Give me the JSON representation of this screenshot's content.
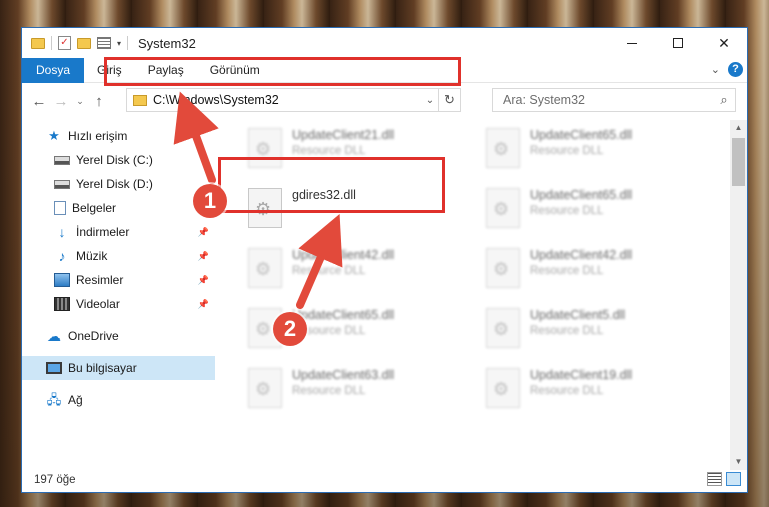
{
  "window": {
    "title": "System32"
  },
  "ribbon": {
    "tabs": [
      "Dosya",
      "Giriş",
      "Paylaş",
      "Görünüm"
    ],
    "help": "?"
  },
  "navigation": {
    "back": "←",
    "forward": "→",
    "recent": "⌄",
    "up": "↑",
    "address": "C:\\Windows\\System32",
    "refresh": "↻",
    "search_placeholder": "Ara: System32"
  },
  "sidebar": {
    "items": [
      {
        "label": "Hızlı erişim",
        "icon": "star-icon"
      },
      {
        "label": "Yerel Disk (C:)",
        "icon": "disk-icon"
      },
      {
        "label": "Yerel Disk (D:)",
        "icon": "disk-icon"
      },
      {
        "label": "Belgeler",
        "icon": "documents-icon"
      },
      {
        "label": "İndirmeler",
        "icon": "download-icon",
        "pinned": true
      },
      {
        "label": "Müzik",
        "icon": "music-icon",
        "pinned": true
      },
      {
        "label": "Resimler",
        "icon": "pictures-icon",
        "pinned": true
      },
      {
        "label": "Videolar",
        "icon": "videos-icon",
        "pinned": true
      },
      {
        "label": "OneDrive",
        "icon": "cloud-icon"
      },
      {
        "label": "Bu bilgisayar",
        "icon": "computer-icon",
        "selected": true
      },
      {
        "label": "Ağ",
        "icon": "network-icon"
      }
    ]
  },
  "files": {
    "left_column": [
      {
        "name": "UpdateClient21.dll",
        "type": "Resource DLL"
      },
      {
        "name": "gdires32.dll",
        "type": ""
      },
      {
        "name": "UpdateClient42.dll",
        "type": "Resource DLL"
      },
      {
        "name": "UpdateClient65.dll",
        "type": "Resource DLL"
      },
      {
        "name": "UpdateClient63.dll",
        "type": "Resource DLL"
      }
    ],
    "right_column": [
      {
        "name": "UpdateClient65.dll",
        "type": "Resource DLL"
      },
      {
        "name": "UpdateClient65.dll",
        "type": "Resource DLL"
      },
      {
        "name": "UpdateClient42.dll",
        "type": "Resource DLL"
      },
      {
        "name": "UpdateClient5.dll",
        "type": "Resource DLL"
      },
      {
        "name": "UpdateClient19.dll",
        "type": "Resource DLL"
      }
    ]
  },
  "status": {
    "item_count": "197 öğe"
  },
  "callouts": {
    "one": "1",
    "two": "2"
  },
  "colors": {
    "accent": "#1979ca",
    "highlight_red": "#e0312b",
    "callout": "#e24a3b",
    "selection": "#cde6f7"
  }
}
